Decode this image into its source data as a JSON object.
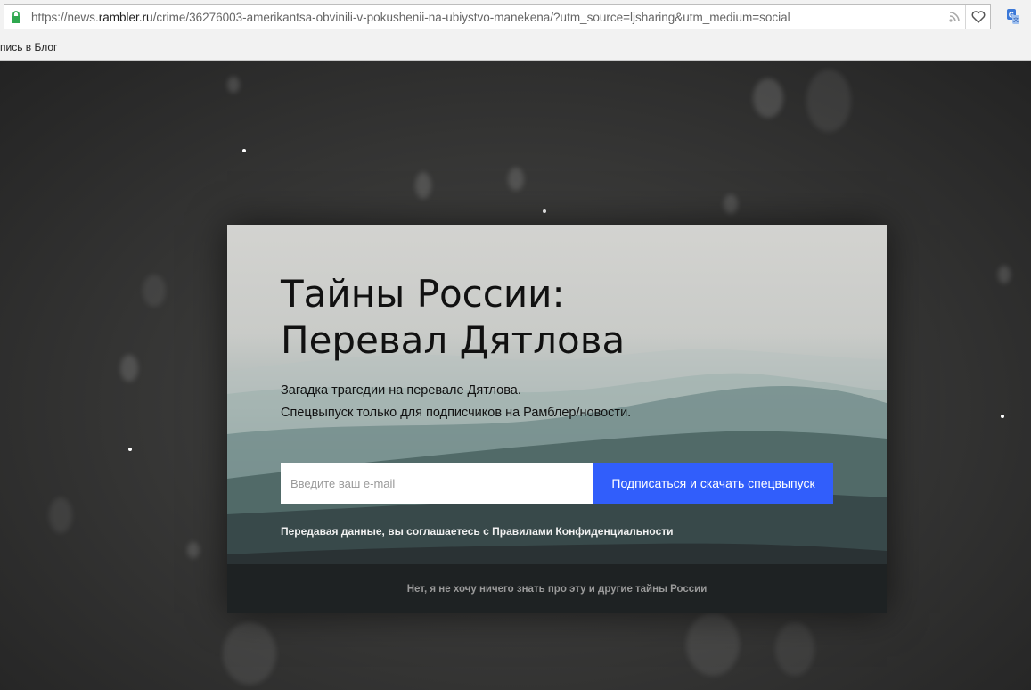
{
  "browser": {
    "url_prefix": "https://news.",
    "url_host": "rambler.ru",
    "url_path": "/crime/36276003-amerikantsa-obvinili-v-pokushenii-na-ubiystvo-manekena/?utm_source=ljsharing&utm_medium=social",
    "bookmark_label": "пись в Блог",
    "icons": {
      "lock": "lock-icon",
      "rss": "rss-icon",
      "heart": "heart-icon",
      "extension": "extension-icon"
    },
    "colors": {
      "lock": "#2fa84f",
      "extension": "#3b78d8"
    }
  },
  "modal": {
    "title_line1": "Тайны России:",
    "title_line2": "Перевал Дятлова",
    "desc_line1": "Загадка трагедии на перевале Дятлова.",
    "desc_line2": "Спецвыпуск только для подписчиков на Рамблер/новости.",
    "email_placeholder": "Введите ваш e-mail",
    "email_value": "",
    "subscribe_label": "Подписаться и скачать спецвыпуск",
    "legal_prefix": "Передавая данные, вы соглашаетесь с ",
    "legal_link": "Правилами Конфиденциальности",
    "decline_label": "Нет, я не хочу ничего знать про эту и другие тайны России",
    "colors": {
      "button": "#315efb",
      "title": "#111111"
    }
  }
}
